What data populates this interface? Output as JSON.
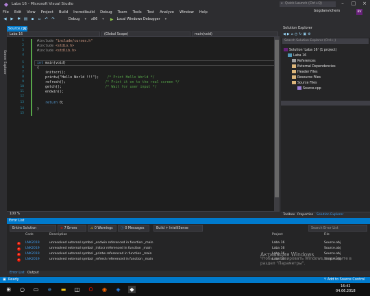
{
  "window": {
    "title": "Laba 16 - Microsoft Visual Studio",
    "quick_launch": "Quick Launch (Ctrl+Q)",
    "vs_icon": "visual-studio-icon"
  },
  "menu": {
    "items": [
      "File",
      "Edit",
      "View",
      "Project",
      "Build",
      "Incredibuild",
      "Debug",
      "Team",
      "Tools",
      "Test",
      "Analyze",
      "Window",
      "Help"
    ],
    "user": "bogdanvichers",
    "avatar": "BV"
  },
  "toolbar": {
    "config": "Debug",
    "platform": "x86",
    "debugger": "Local Windows Debugger"
  },
  "left_tab": "Server Explorer",
  "editor": {
    "tab": "Source.cpp",
    "nav_project": "Laba 16",
    "nav_scope": "(Global Scope)",
    "nav_member": "main(void)",
    "zoom": "100 %",
    "line_numbers": [
      "1",
      "2",
      "3",
      "4",
      "5",
      "6",
      "7",
      "8",
      "9",
      "10",
      "11",
      "12",
      "13",
      "14",
      "15"
    ],
    "lines": [
      {
        "pp": "#include",
        "rest": " \"include/curses.h\""
      },
      {
        "pp": "#include",
        "rest": " <stdio.h>"
      },
      {
        "pp": "#include",
        "rest": " <stdlib.h>"
      },
      {
        "text": ""
      },
      {
        "kw": "int",
        "rest": " main(void)"
      },
      {
        "text": "{"
      },
      {
        "text": "    initscr();"
      },
      {
        "code": "    printw(\"Hello World !!!\");",
        "comment": "    /* Print Hello World */"
      },
      {
        "code": "    refresh();",
        "comment": "                   /* Print it on to the real screen */"
      },
      {
        "code": "    getch();",
        "comment": "                     /* Wait for user input */"
      },
      {
        "text": "    endwin();"
      },
      {
        "text": ""
      },
      {
        "kw": "    return",
        "rest": " 0;"
      },
      {
        "text": "}"
      },
      {
        "text": ""
      }
    ]
  },
  "solution_explorer": {
    "title": "Solution Explorer",
    "search": "Search Solution Explorer (Ctrl+;)",
    "items": [
      {
        "label": "Solution 'Laba 16' (1 project)"
      },
      {
        "label": "Laba 16"
      },
      {
        "label": "References"
      },
      {
        "label": "External Dependencies"
      },
      {
        "label": "Header Files"
      },
      {
        "label": "Resource Files"
      },
      {
        "label": "Source Files"
      },
      {
        "label": "Source.cpp"
      }
    ],
    "tabs": [
      "Toolbox",
      "Properties",
      "Solution Explorer"
    ]
  },
  "error_list": {
    "title": "Error List",
    "scope": "Entire Solution",
    "errors_btn": "7 Errors",
    "warnings_btn": "0 Warnings",
    "messages_btn": "0 Messages",
    "build_filter": "Build + IntelliSense",
    "search": "Search Error List",
    "columns": {
      "code": "Code",
      "description": "Description",
      "project": "Project",
      "file": "File"
    },
    "rows": [
      {
        "code": "LNK2019",
        "description": "unresolved external symbol _endwin referenced in function _main",
        "project": "Laba 16",
        "file": "Source.obj"
      },
      {
        "code": "LNK2019",
        "description": "unresolved external symbol _initscr referenced in function _main",
        "project": "Laba 16",
        "file": "Source.obj"
      },
      {
        "code": "LNK2019",
        "description": "unresolved external symbol _printw referenced in function _main",
        "project": "Laba 16",
        "file": "Source.obj"
      },
      {
        "code": "LNK2019",
        "description": "unresolved external symbol _refresh referenced in function _main",
        "project": "Laba 16",
        "file": "Source.obj"
      }
    ],
    "bottom_tabs": [
      "Error List",
      "Output"
    ]
  },
  "watermark": {
    "line1": "Активация Windows",
    "line2": "Чтобы активировать Windows, перейдите в",
    "line3": "раздел \"Параметры\"."
  },
  "status": {
    "left": "Ready",
    "right": "Add to Source Control"
  },
  "taskbar": {
    "time": "16:42",
    "date": "04.06.2018"
  },
  "colors": {
    "accent": "#007acc",
    "error": "#e51400",
    "comment": "#57a64a",
    "keyword": "#569cd6"
  }
}
